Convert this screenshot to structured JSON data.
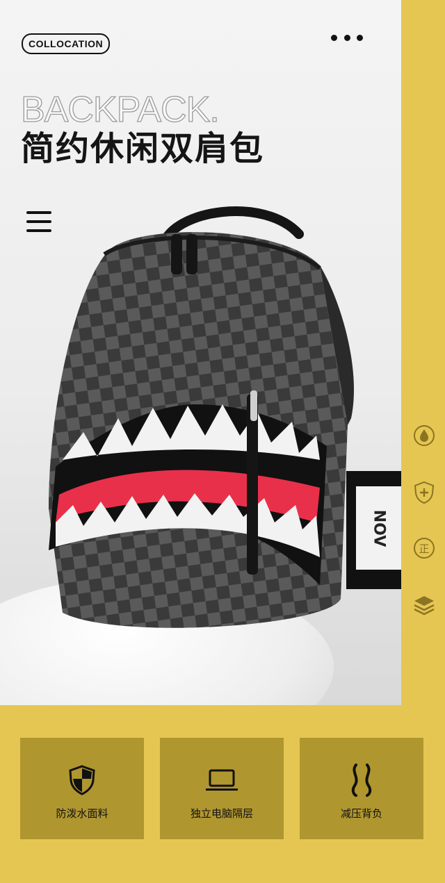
{
  "header": {
    "badge_label": "COLLOCATION",
    "more_icon": "more-dots-icon",
    "menu_icon": "hamburger-menu-icon"
  },
  "headline": {
    "english": "BACKPACK.",
    "chinese": "简约休闲双肩包"
  },
  "prop_card_text": "NOV",
  "side_icons": [
    "water-drop-icon",
    "shield-plus-icon",
    "genuine-seal-icon",
    "layers-icon"
  ],
  "side_seal_text": "正",
  "features": [
    {
      "icon": "shield-icon",
      "label": "防泼水面料"
    },
    {
      "icon": "laptop-icon",
      "label": "独立电脑隔层"
    },
    {
      "icon": "back-curve-icon",
      "label": "减压背负"
    }
  ],
  "colors": {
    "accent": "#e5c652",
    "card": "#b0962f",
    "text": "#111111",
    "shark_red": "#e8304a"
  }
}
